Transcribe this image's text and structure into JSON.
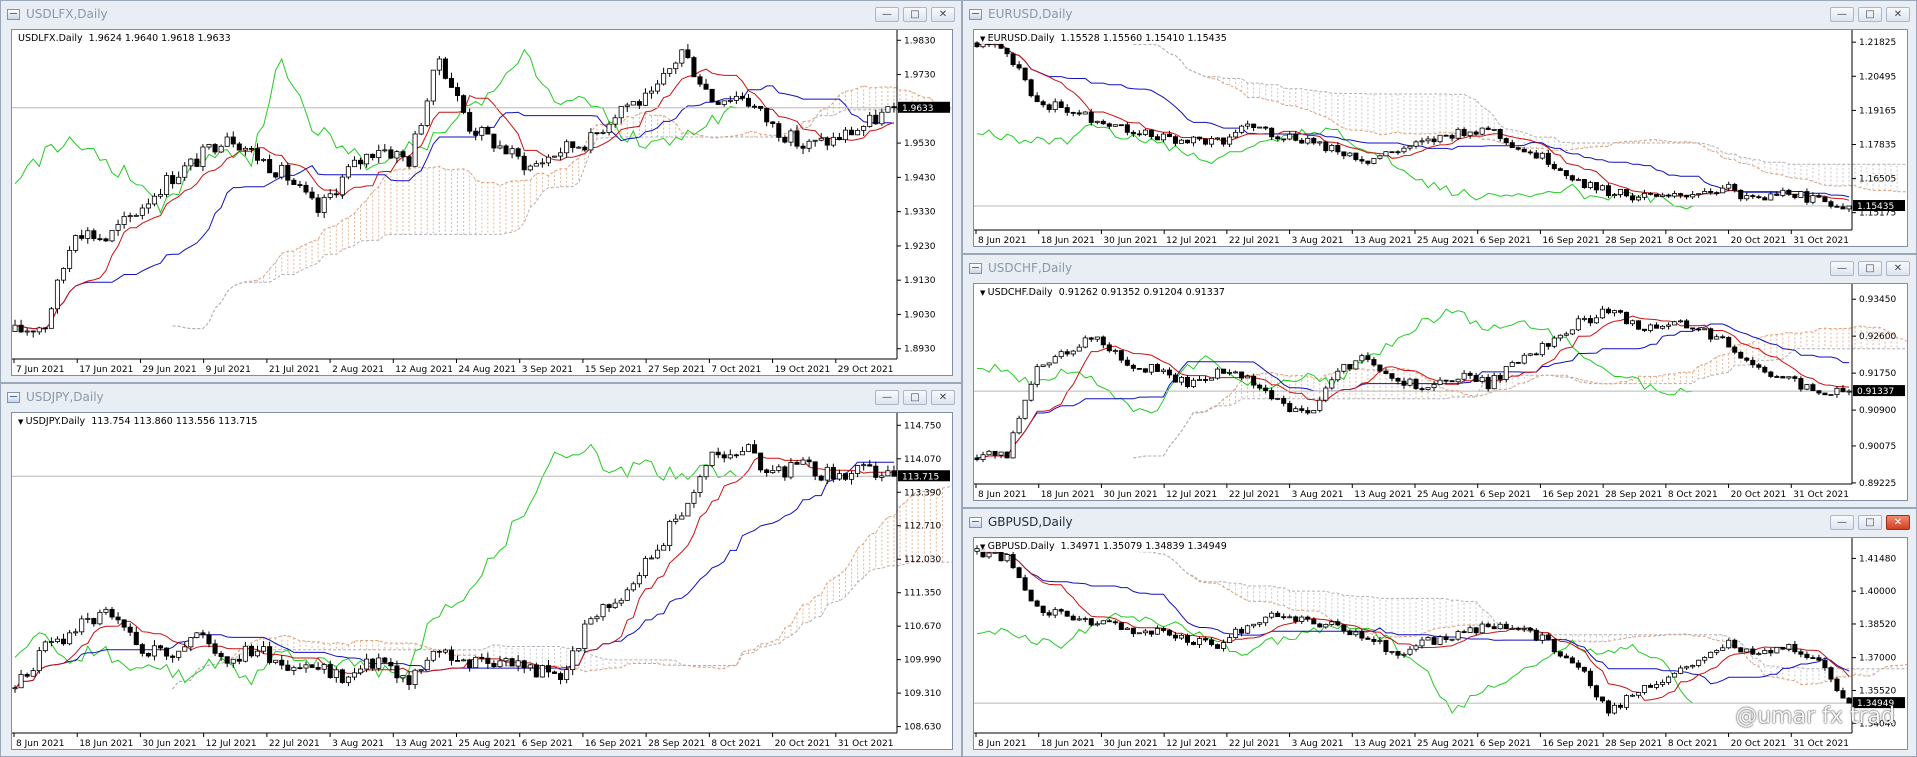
{
  "watermark": "@umar fx trad",
  "panels": [
    {
      "id": "usdlfx",
      "title": "USDLFX,Daily",
      "info": "USDLFX.Daily  1.9624 1.9640 1.9618 1.9633",
      "active": false,
      "close_btn_red": false,
      "has_arrow": false,
      "ylim": [
        1.89,
        1.986
      ],
      "price_ticks": [
        "1.9830",
        "1.9730",
        "1.9630",
        "1.9530",
        "1.9430",
        "1.9330",
        "1.9230",
        "1.9130",
        "1.9030",
        "1.8930"
      ],
      "current": "1.9633",
      "current_value": 1.9633,
      "x_labels": [
        "7 Jun 2021",
        "17 Jun 2021",
        "29 Jun 2021",
        "9 Jul 2021",
        "21 Jul 2021",
        "2 Aug 2021",
        "12 Aug 2021",
        "24 Aug 2021",
        "3 Sep 2021",
        "15 Sep 2021",
        "27 Sep 2021",
        "7 Oct 2021",
        "19 Oct 2021",
        "29 Oct 2021"
      ]
    },
    {
      "id": "eurusd",
      "title": "EURUSD,Daily",
      "info": "EURUSD.Daily  1.15528 1.15560 1.15410 1.15435",
      "active": false,
      "close_btn_red": false,
      "has_arrow": true,
      "ylim": [
        1.145,
        1.223
      ],
      "price_ticks": [
        "1.21825",
        "1.20495",
        "1.19165",
        "1.17835",
        "1.16505",
        "1.15175"
      ],
      "current": "1.15435",
      "current_value": 1.15435,
      "x_labels": [
        "8 Jun 2021",
        "18 Jun 2021",
        "30 Jun 2021",
        "12 Jul 2021",
        "22 Jul 2021",
        "3 Aug 2021",
        "13 Aug 2021",
        "25 Aug 2021",
        "6 Sep 2021",
        "16 Sep 2021",
        "28 Sep 2021",
        "8 Oct 2021",
        "20 Oct 2021",
        "31 Oct 2021"
      ]
    },
    {
      "id": "usdchf",
      "title": "USDCHF,Daily",
      "info": "USDCHF.Daily  0.91262 0.91352 0.91204 0.91337",
      "active": false,
      "close_btn_red": false,
      "has_arrow": true,
      "ylim": [
        0.892,
        0.938
      ],
      "price_ticks": [
        "0.93450",
        "0.92600",
        "0.91750",
        "0.90900",
        "0.90075",
        "0.89225"
      ],
      "current": "0.91337",
      "current_value": 0.91337,
      "x_labels": [
        "8 Jun 2021",
        "18 Jun 2021",
        "30 Jun 2021",
        "12 Jul 2021",
        "22 Jul 2021",
        "3 Aug 2021",
        "13 Aug 2021",
        "25 Aug 2021",
        "6 Sep 2021",
        "16 Sep 2021",
        "28 Sep 2021",
        "8 Oct 2021",
        "20 Oct 2021",
        "31 Oct 2021"
      ]
    },
    {
      "id": "usdjpy",
      "title": "USDJPY,Daily",
      "info": "USDJPY.Daily  113.754 113.860 113.556 113.715",
      "active": false,
      "close_btn_red": false,
      "has_arrow": true,
      "ylim": [
        108.5,
        115.0
      ],
      "price_ticks": [
        "114.750",
        "114.070",
        "113.390",
        "112.710",
        "112.030",
        "111.350",
        "110.670",
        "109.990",
        "109.310",
        "108.630"
      ],
      "current": "113.715",
      "current_value": 113.715,
      "x_labels": [
        "8 Jun 2021",
        "18 Jun 2021",
        "30 Jun 2021",
        "12 Jul 2021",
        "22 Jul 2021",
        "3 Aug 2021",
        "13 Aug 2021",
        "25 Aug 2021",
        "6 Sep 2021",
        "16 Sep 2021",
        "28 Sep 2021",
        "8 Oct 2021",
        "20 Oct 2021",
        "31 Oct 2021"
      ]
    },
    {
      "id": "gbpusd",
      "title": "GBPUSD,Daily",
      "info": "GBPUSD.Daily  1.34971 1.35079 1.34839 1.34949",
      "active": true,
      "close_btn_red": true,
      "has_arrow": true,
      "ylim": [
        1.336,
        1.424
      ],
      "price_ticks": [
        "1.41480",
        "1.40000",
        "1.38520",
        "1.37000",
        "1.35520",
        "1.34040"
      ],
      "current": "1.34949",
      "current_value": 1.34949,
      "x_labels": [
        "8 Jun 2021",
        "18 Jun 2021",
        "30 Jun 2021",
        "12 Jul 2021",
        "22 Jul 2021",
        "3 Aug 2021",
        "13 Aug 2021",
        "25 Aug 2021",
        "6 Sep 2021",
        "16 Sep 2021",
        "28 Sep 2021",
        "8 Oct 2021",
        "20 Oct 2021",
        "31 Oct 2021"
      ]
    }
  ],
  "chart_data": [
    {
      "type": "candlestick",
      "series_name": "USDLFX.Daily",
      "ylim": [
        1.89,
        1.986
      ],
      "anchors": [
        [
          0,
          1.898
        ],
        [
          5,
          1.9
        ],
        [
          10,
          1.928
        ],
        [
          15,
          1.925
        ],
        [
          20,
          1.933
        ],
        [
          25,
          1.942
        ],
        [
          30,
          1.948
        ],
        [
          35,
          1.956
        ],
        [
          40,
          1.949
        ],
        [
          45,
          1.943
        ],
        [
          50,
          1.933
        ],
        [
          55,
          1.945
        ],
        [
          60,
          1.952
        ],
        [
          65,
          1.948
        ],
        [
          70,
          1.978
        ],
        [
          75,
          1.958
        ],
        [
          80,
          1.952
        ],
        [
          85,
          1.946
        ],
        [
          90,
          1.951
        ],
        [
          95,
          1.954
        ],
        [
          100,
          1.964
        ],
        [
          105,
          1.966
        ],
        [
          110,
          1.98
        ],
        [
          115,
          1.966
        ],
        [
          120,
          1.967
        ],
        [
          125,
          1.958
        ],
        [
          130,
          1.952
        ],
        [
          135,
          1.954
        ],
        [
          140,
          1.958
        ],
        [
          145,
          1.9633
        ]
      ]
    },
    {
      "type": "candlestick",
      "series_name": "EURUSD.Daily",
      "ylim": [
        1.145,
        1.223
      ],
      "anchors": [
        [
          0,
          1.218
        ],
        [
          5,
          1.215
        ],
        [
          10,
          1.195
        ],
        [
          15,
          1.192
        ],
        [
          20,
          1.188
        ],
        [
          25,
          1.185
        ],
        [
          30,
          1.181
        ],
        [
          35,
          1.18
        ],
        [
          40,
          1.179
        ],
        [
          45,
          1.186
        ],
        [
          50,
          1.182
        ],
        [
          55,
          1.18
        ],
        [
          60,
          1.176
        ],
        [
          65,
          1.172
        ],
        [
          70,
          1.176
        ],
        [
          75,
          1.179
        ],
        [
          80,
          1.183
        ],
        [
          85,
          1.185
        ],
        [
          90,
          1.177
        ],
        [
          95,
          1.172
        ],
        [
          100,
          1.164
        ],
        [
          105,
          1.16
        ],
        [
          110,
          1.158
        ],
        [
          115,
          1.157
        ],
        [
          120,
          1.16
        ],
        [
          125,
          1.161
        ],
        [
          130,
          1.156
        ],
        [
          135,
          1.16
        ],
        [
          140,
          1.156
        ],
        [
          145,
          1.15435
        ]
      ]
    },
    {
      "type": "candlestick",
      "series_name": "USDCHF.Daily",
      "ylim": [
        0.892,
        0.938
      ],
      "anchors": [
        [
          0,
          0.898
        ],
        [
          5,
          0.899
        ],
        [
          10,
          0.918
        ],
        [
          15,
          0.923
        ],
        [
          20,
          0.926
        ],
        [
          25,
          0.92
        ],
        [
          30,
          0.918
        ],
        [
          35,
          0.915
        ],
        [
          40,
          0.918
        ],
        [
          45,
          0.916
        ],
        [
          50,
          0.911
        ],
        [
          55,
          0.908
        ],
        [
          60,
          0.918
        ],
        [
          65,
          0.921
        ],
        [
          70,
          0.916
        ],
        [
          75,
          0.914
        ],
        [
          80,
          0.917
        ],
        [
          85,
          0.915
        ],
        [
          90,
          0.92
        ],
        [
          95,
          0.924
        ],
        [
          100,
          0.929
        ],
        [
          105,
          0.932
        ],
        [
          110,
          0.928
        ],
        [
          115,
          0.929
        ],
        [
          120,
          0.928
        ],
        [
          125,
          0.924
        ],
        [
          130,
          0.919
        ],
        [
          135,
          0.916
        ],
        [
          140,
          0.913
        ],
        [
          145,
          0.91337
        ]
      ]
    },
    {
      "type": "candlestick",
      "series_name": "USDJPY.Daily",
      "ylim": [
        108.5,
        115.0
      ],
      "anchors": [
        [
          0,
          109.4
        ],
        [
          5,
          110.2
        ],
        [
          10,
          110.6
        ],
        [
          15,
          110.9
        ],
        [
          20,
          110.3
        ],
        [
          25,
          110.1
        ],
        [
          30,
          110.5
        ],
        [
          35,
          110.0
        ],
        [
          40,
          110.2
        ],
        [
          45,
          109.9
        ],
        [
          50,
          109.8
        ],
        [
          55,
          109.6
        ],
        [
          60,
          110.0
        ],
        [
          65,
          109.5
        ],
        [
          70,
          110.2
        ],
        [
          75,
          109.9
        ],
        [
          80,
          110.0
        ],
        [
          85,
          109.8
        ],
        [
          90,
          109.6
        ],
        [
          95,
          110.8
        ],
        [
          100,
          111.3
        ],
        [
          105,
          112.1
        ],
        [
          110,
          113.0
        ],
        [
          115,
          114.1
        ],
        [
          120,
          114.3
        ],
        [
          125,
          113.8
        ],
        [
          130,
          113.9
        ],
        [
          135,
          113.7
        ],
        [
          140,
          113.8
        ],
        [
          145,
          113.715
        ]
      ]
    },
    {
      "type": "candlestick",
      "series_name": "GBPUSD.Daily",
      "ylim": [
        1.336,
        1.424
      ],
      "anchors": [
        [
          0,
          1.418
        ],
        [
          5,
          1.415
        ],
        [
          10,
          1.392
        ],
        [
          15,
          1.388
        ],
        [
          20,
          1.385
        ],
        [
          25,
          1.383
        ],
        [
          30,
          1.382
        ],
        [
          35,
          1.378
        ],
        [
          40,
          1.376
        ],
        [
          45,
          1.385
        ],
        [
          50,
          1.39
        ],
        [
          55,
          1.387
        ],
        [
          60,
          1.384
        ],
        [
          65,
          1.378
        ],
        [
          70,
          1.372
        ],
        [
          75,
          1.377
        ],
        [
          80,
          1.381
        ],
        [
          85,
          1.384
        ],
        [
          90,
          1.383
        ],
        [
          95,
          1.377
        ],
        [
          100,
          1.366
        ],
        [
          105,
          1.345
        ],
        [
          110,
          1.356
        ],
        [
          115,
          1.362
        ],
        [
          120,
          1.37
        ],
        [
          125,
          1.376
        ],
        [
          130,
          1.372
        ],
        [
          135,
          1.374
        ],
        [
          140,
          1.369
        ],
        [
          145,
          1.34949
        ]
      ]
    }
  ]
}
